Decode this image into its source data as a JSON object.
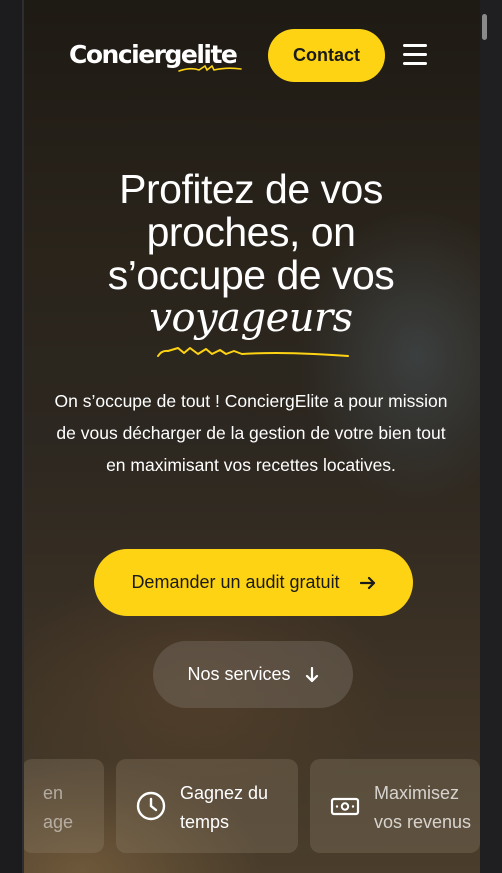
{
  "header": {
    "logo_text": "Conciergelite",
    "contact_label": "Contact"
  },
  "hero": {
    "title_lines": [
      "Profitez de vos",
      "proches, on",
      "s’occupe de vos"
    ],
    "title_accent": "voyageurs",
    "description": "On s’occupe de tout ! ConciergElite a pour mission de vous décharger de la gestion de votre bien tout en maximisant vos recettes locatives.",
    "primary_cta": "Demander un audit gratuit",
    "secondary_cta": "Nos services"
  },
  "features": [
    {
      "line1": "en",
      "line2": "age",
      "icon": "partial"
    },
    {
      "line1": "Gagnez du",
      "line2": "temps",
      "icon": "clock-icon"
    },
    {
      "line1": "Maximisez",
      "line2": "vos revenus",
      "icon": "money-icon"
    }
  ],
  "colors": {
    "accent": "#fdd314",
    "text": "#ffffff"
  }
}
